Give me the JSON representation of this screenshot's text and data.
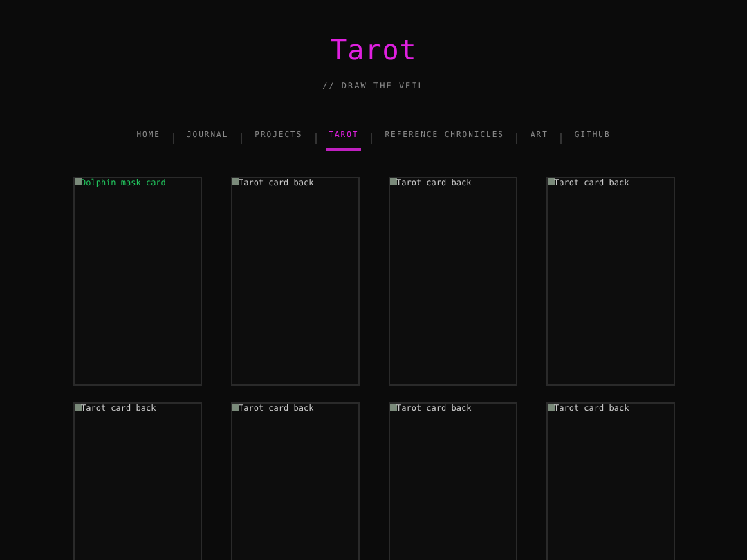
{
  "header": {
    "title": "Tarot",
    "subtitle": "// DRAW THE VEIL"
  },
  "nav": [
    {
      "label": "HOME",
      "selected": false
    },
    {
      "label": "JOURNAL",
      "selected": false
    },
    {
      "label": "PROJECTS",
      "selected": false
    },
    {
      "label": "TAROT",
      "selected": true
    },
    {
      "label": "REFERENCE CHRONICLES",
      "selected": false
    },
    {
      "label": "ART",
      "selected": false
    },
    {
      "label": "GITHUB",
      "selected": false
    }
  ],
  "cards": [
    {
      "alt": "Dolphin mask card",
      "color": "#22c55e"
    },
    {
      "alt": "Tarot card back",
      "color": "#cccccc"
    },
    {
      "alt": "Tarot card back",
      "color": "#cccccc"
    },
    {
      "alt": "Tarot card back",
      "color": "#cccccc"
    },
    {
      "alt": "Tarot card back",
      "color": "#cccccc"
    },
    {
      "alt": "Tarot card back",
      "color": "#cccccc"
    },
    {
      "alt": "Tarot card back",
      "color": "#cccccc"
    },
    {
      "alt": "Tarot card back",
      "color": "#cccccc"
    }
  ]
}
